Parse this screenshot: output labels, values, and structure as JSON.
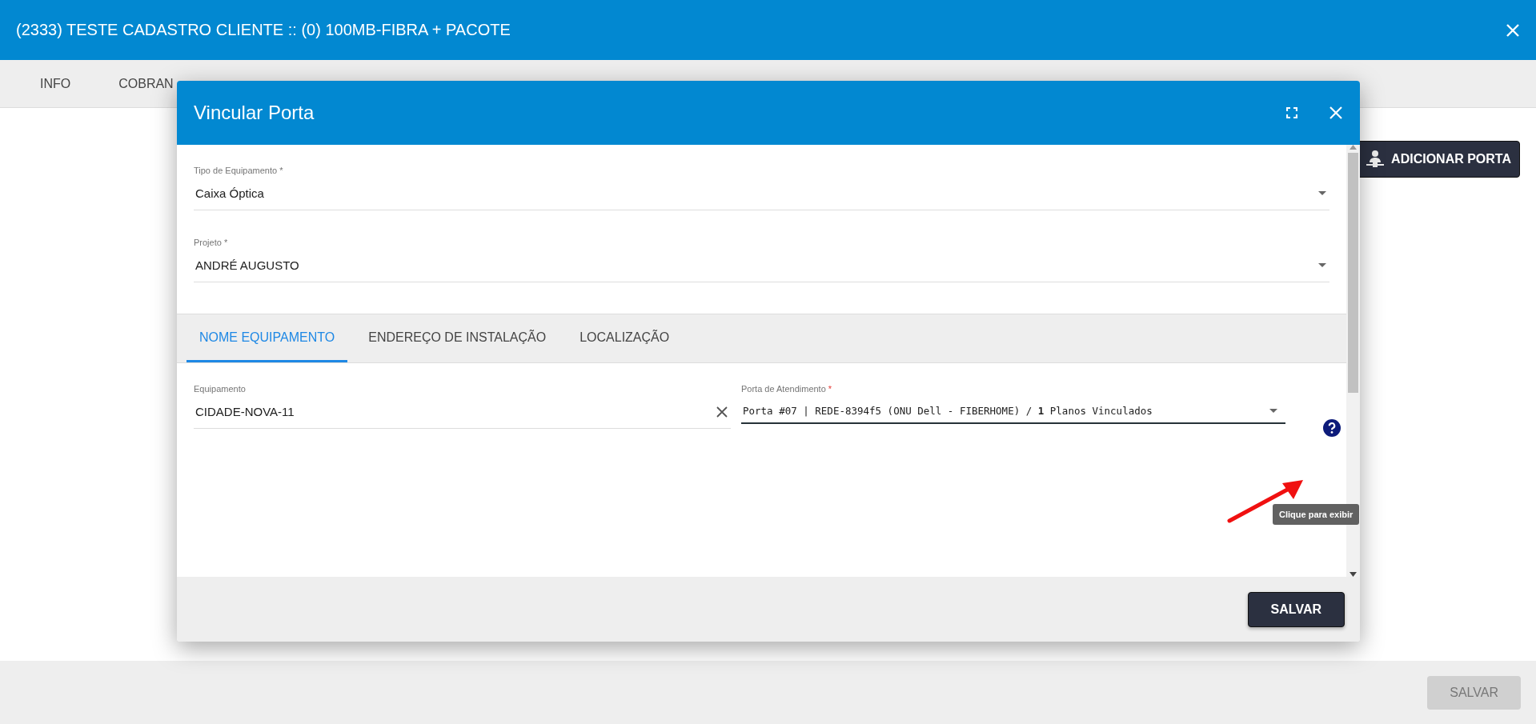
{
  "window": {
    "title": "(2333) TESTE CADASTRO CLIENTE :: (0) 100MB-FIBRA + PACOTE"
  },
  "tabs": [
    {
      "label": "INFO",
      "selected": false
    },
    {
      "label": "COBRAN",
      "selected": false
    }
  ],
  "add_port_button": {
    "label": "ADICIONAR PORTA"
  },
  "save_button": {
    "label": "SALVAR",
    "disabled": true
  },
  "dialog": {
    "title": "Vincular Porta",
    "fields": [
      {
        "label": "Tipo de Equipamento *",
        "value": "Caixa Óptica"
      },
      {
        "label": "Projeto *",
        "value": "ANDRÉ AUGUSTO"
      }
    ],
    "tabs": [
      {
        "label": "NOME EQUIPAMENTO",
        "selected": true
      },
      {
        "label": "ENDEREÇO DE INSTALAÇÃO",
        "selected": false
      },
      {
        "label": "LOCALIZAÇÃO",
        "selected": false
      }
    ],
    "equipment": {
      "label": "Equipamento",
      "value": "CIDADE-NOVA-11"
    },
    "port": {
      "label": "Porta de Atendimento",
      "required_mark": "*",
      "value": "Porta #07 | REDE-8394f5 (ONU Dell - FIBERHOME) / **1** Planos Vinculados"
    },
    "tooltip": "Clique para exibir",
    "save_button": {
      "label": "SALVAR",
      "disabled": false
    }
  }
}
